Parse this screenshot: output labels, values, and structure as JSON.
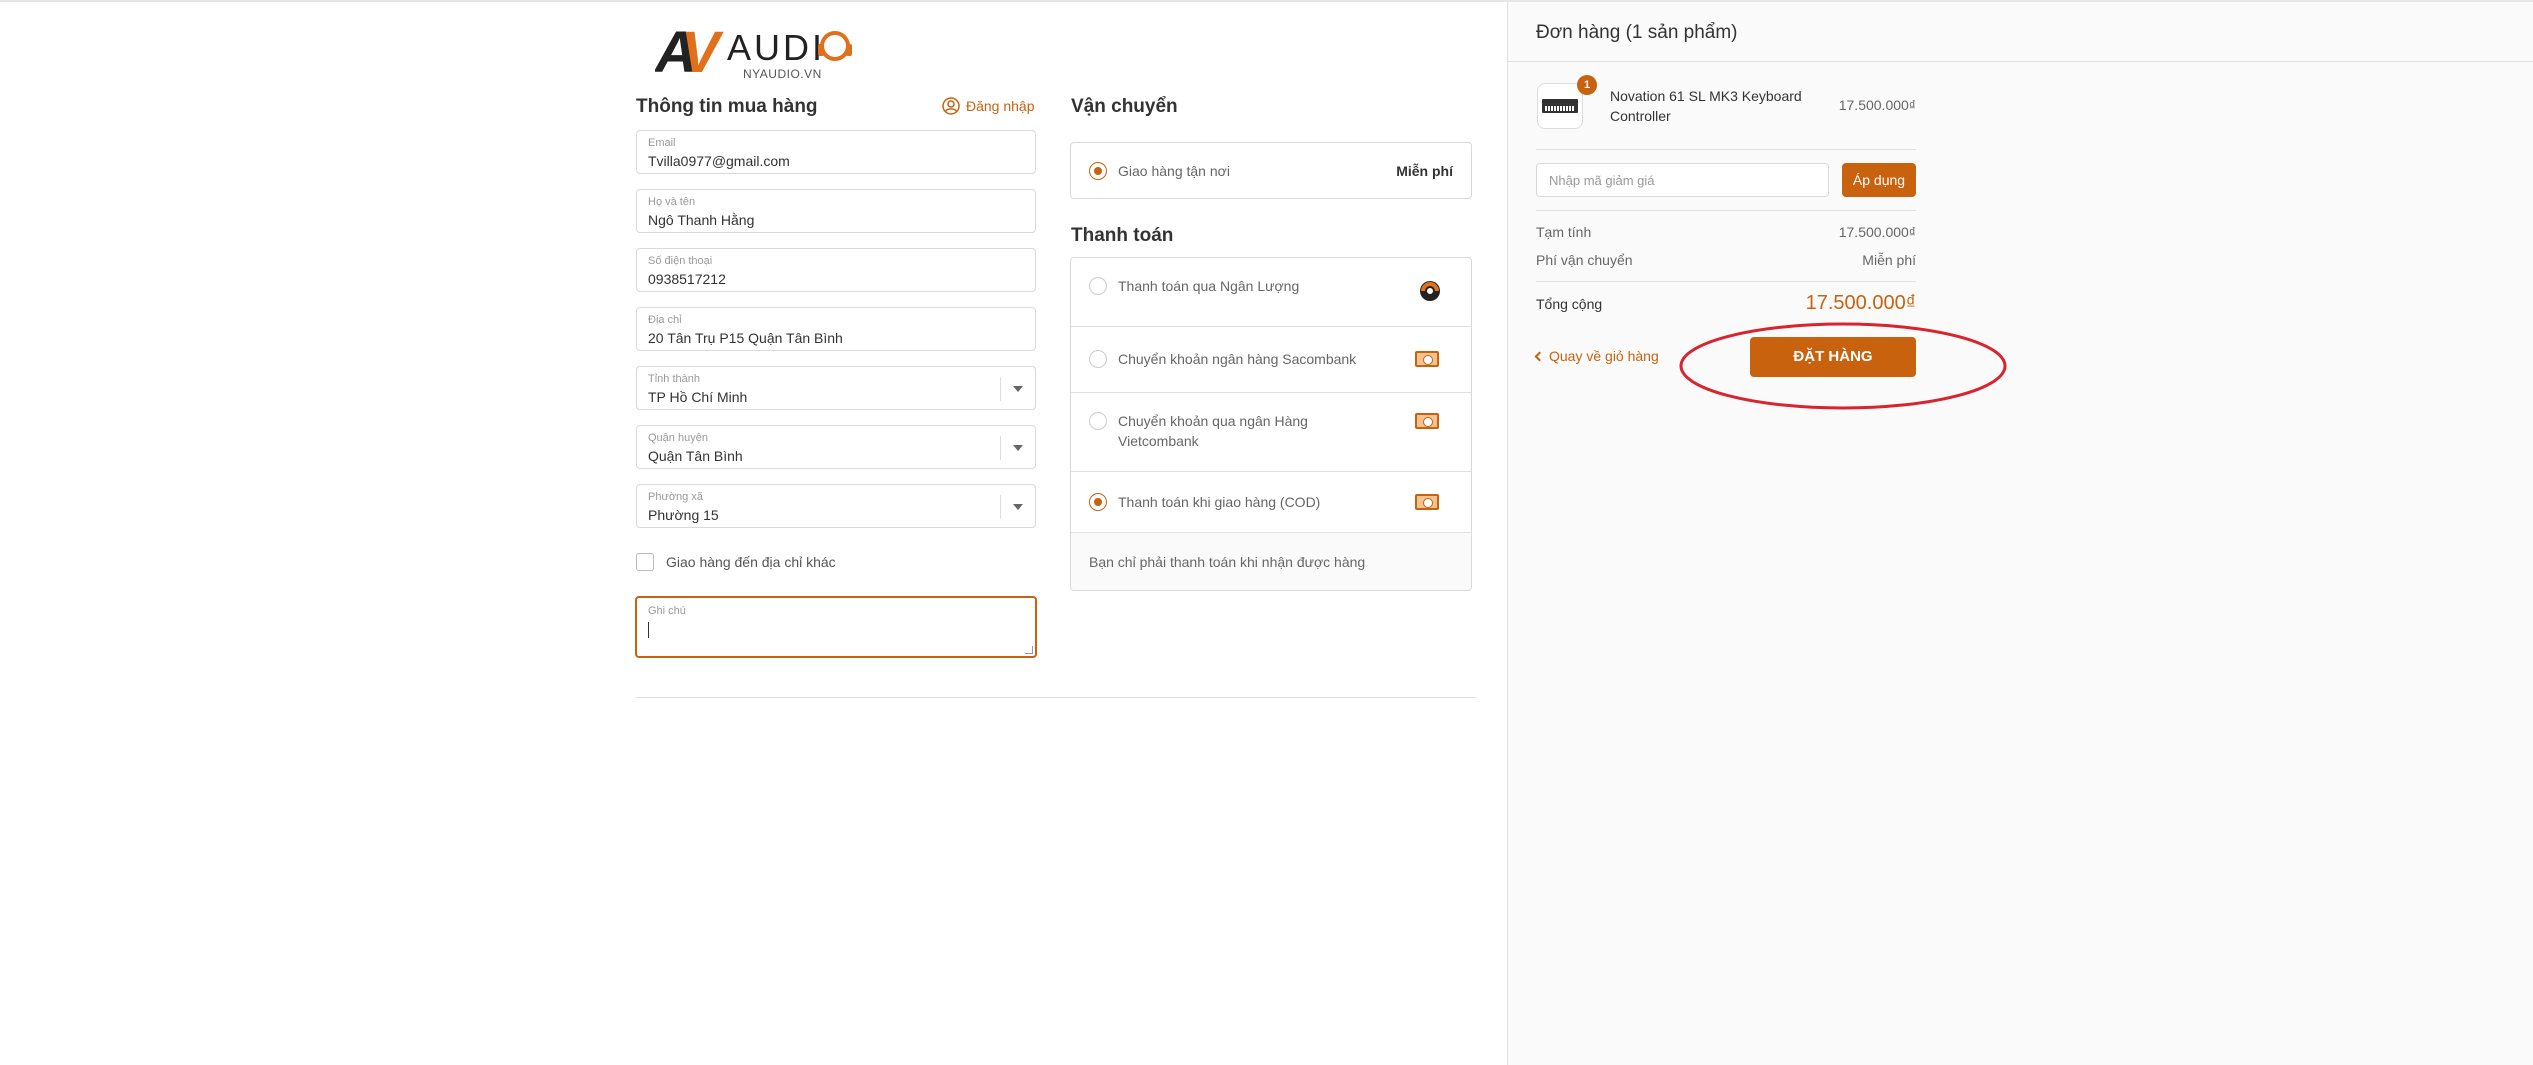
{
  "brand": {
    "logo_initials": "AV",
    "logo_word": "AUDIO",
    "logo_domain": "NYAUDIO.VN",
    "accent_color": "#c8620e"
  },
  "customer": {
    "title": "Thông tin mua hàng",
    "login_label": "Đăng nhập",
    "fields": [
      {
        "label": "Email",
        "value": "Tvilla0977@gmail.com"
      },
      {
        "label": "Họ và tên",
        "value": "Ngô Thanh Hằng"
      },
      {
        "label": "Số điện thoại",
        "value": "0938517212"
      },
      {
        "label": "Địa chỉ",
        "value": "20 Tân Trụ P15 Quận Tân Bình"
      },
      {
        "label": "Tỉnh thành",
        "value": "TP Hồ Chí Minh"
      },
      {
        "label": "Quận huyện",
        "value": "Quận Tân Bình"
      },
      {
        "label": "Phường xã",
        "value": "Phường 15"
      }
    ],
    "other_address_label": "Giao hàng đến địa chỉ khác",
    "note_label": "Ghi chú"
  },
  "shipping": {
    "title": "Vận chuyển",
    "option_label": "Giao hàng tận nơi",
    "option_price": "Miễn phí"
  },
  "payment": {
    "title": "Thanh toán",
    "options": [
      {
        "label": "Thanh toán qua Ngân Lượng",
        "icon": "nganluong-logo-icon"
      },
      {
        "label": "Chuyển khoản ngân hàng Sacombank",
        "icon": "cash-icon"
      },
      {
        "label": "Chuyển khoản qua ngân Hàng Vietcombank",
        "icon": "cash-icon"
      },
      {
        "label": "Thanh toán khi giao hàng (COD)",
        "icon": "cash-icon",
        "selected": true
      }
    ],
    "cod_description": "Bạn chỉ phải thanh toán khi nhận được hàng"
  },
  "order": {
    "title": "Đơn hàng (1 sản phẩm)",
    "item": {
      "name": "Novation 61 SL MK3 Keyboard Controller",
      "quantity": "1",
      "price": "17.500.000₫"
    },
    "coupon_placeholder": "Nhập mã giảm giá",
    "apply_label": "Áp dụng",
    "subtotal_label": "Tạm tính",
    "subtotal_value": "17.500.000₫",
    "shipping_fee_label": "Phí vận chuyển",
    "shipping_fee_value": "Miễn phí",
    "total_label": "Tổng cộng",
    "total_value": "17.500.000₫",
    "back_label": "Quay về giỏ hàng",
    "place_order_label": "ĐẶT HÀNG",
    "annotation_color": "#d9232e"
  }
}
